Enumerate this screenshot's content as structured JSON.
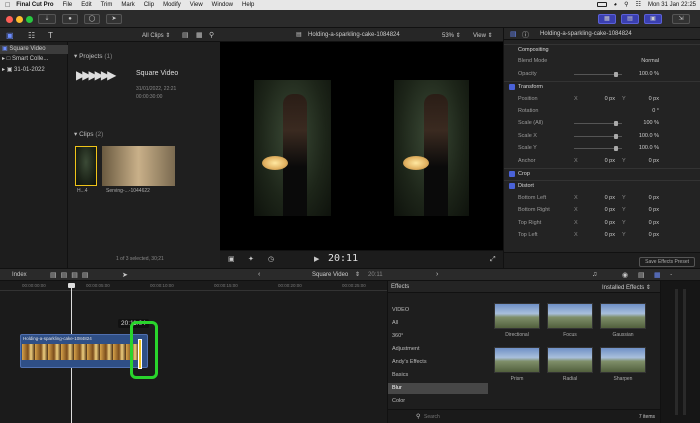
{
  "menubar": {
    "app": "Final Cut Pro",
    "items": [
      "File",
      "Edit",
      "Trim",
      "Mark",
      "Clip",
      "Modify",
      "View",
      "Window",
      "Help"
    ],
    "clock": "Mon 31 Jan 22:25"
  },
  "library": {
    "sidebar": [
      {
        "label": "Square Video"
      },
      {
        "label": "Smart Colle..."
      },
      {
        "label": "31-01-2022"
      }
    ],
    "filter": "All Clips",
    "projects_label": "Projects",
    "projects_count": "(1)",
    "project": {
      "name": "Square Video",
      "date": "31/01/2022, 22:21",
      "duration": "00:00:30:00"
    },
    "clips_label": "Clips",
    "clips_count": "(2)",
    "clips": [
      {
        "label": "H...4"
      },
      {
        "label": "Serving-...-1044622"
      }
    ],
    "status": "1 of 3 selected, 30;21"
  },
  "viewer": {
    "clip_name": "Holding-a-sparkling-cake-1084824",
    "zoom": "53%",
    "view_label": "View",
    "timecode": "20:11"
  },
  "inspector": {
    "title": "Holding-a-sparkling-cake-1084824",
    "rows": [
      {
        "label": "Compositing",
        "header": true
      },
      {
        "label": "Blend Mode",
        "value": "Normal"
      },
      {
        "label": "Opacity",
        "value": "100.0 %"
      },
      {
        "label": "Transform",
        "header": true,
        "check": true
      },
      {
        "label": "Position",
        "x": "X",
        "xval": "0 px",
        "y": "Y",
        "yval": "0 px"
      },
      {
        "label": "Rotation",
        "value": "0 °"
      },
      {
        "label": "Scale (All)",
        "value": "100 %"
      },
      {
        "label": "Scale X",
        "value": "100.0 %"
      },
      {
        "label": "Scale Y",
        "value": "100.0 %"
      },
      {
        "label": "Anchor",
        "x": "X",
        "xval": "0 px",
        "y": "Y",
        "yval": "0 px"
      },
      {
        "label": "Crop",
        "header": true,
        "check": true
      },
      {
        "label": "Distort",
        "header": true,
        "check": true
      },
      {
        "label": "Bottom Left",
        "x": "X",
        "xval": "0 px",
        "y": "Y",
        "yval": "0 px"
      },
      {
        "label": "Bottom Right",
        "x": "X",
        "xval": "0 px",
        "y": "Y",
        "yval": "0 px"
      },
      {
        "label": "Top Right",
        "x": "X",
        "xval": "0 px",
        "y": "Y",
        "yval": "0 px"
      },
      {
        "label": "Top Left",
        "x": "X",
        "xval": "0 px",
        "y": "Y",
        "yval": "0 px"
      }
    ],
    "save_button": "Save Effects Preset"
  },
  "timeline": {
    "index_label": "Index",
    "project_name": "Square Video",
    "duration": "20:11",
    "ruler": [
      "00:00:00:00",
      "00:00:05:00",
      "00:00:10:00",
      "00:00:15:00",
      "00:00:20:00",
      "00:00:25:00",
      "00:00:30:00"
    ],
    "clip_label": "Holding-a-sparkling-cake-1084824",
    "tooltip": "20:11:04"
  },
  "effects": {
    "title": "Effects",
    "installed": "Installed Effects",
    "categories": [
      {
        "label": "VIDEO"
      },
      {
        "label": "All"
      },
      {
        "label": "360°"
      },
      {
        "label": "Adjustment"
      },
      {
        "label": "Andy's Effects"
      },
      {
        "label": "Basics"
      },
      {
        "label": "Blur",
        "selected": true
      },
      {
        "label": "Color"
      }
    ],
    "thumbs": [
      {
        "label": "Directional"
      },
      {
        "label": "Focus"
      },
      {
        "label": "Gaussian"
      },
      {
        "label": "Prism"
      },
      {
        "label": "Radial"
      },
      {
        "label": "Sharpen"
      }
    ],
    "search_placeholder": "Search",
    "count": "7 items"
  },
  "colors": {
    "accent": "#4a62d8",
    "highlight": "#29d42c"
  }
}
